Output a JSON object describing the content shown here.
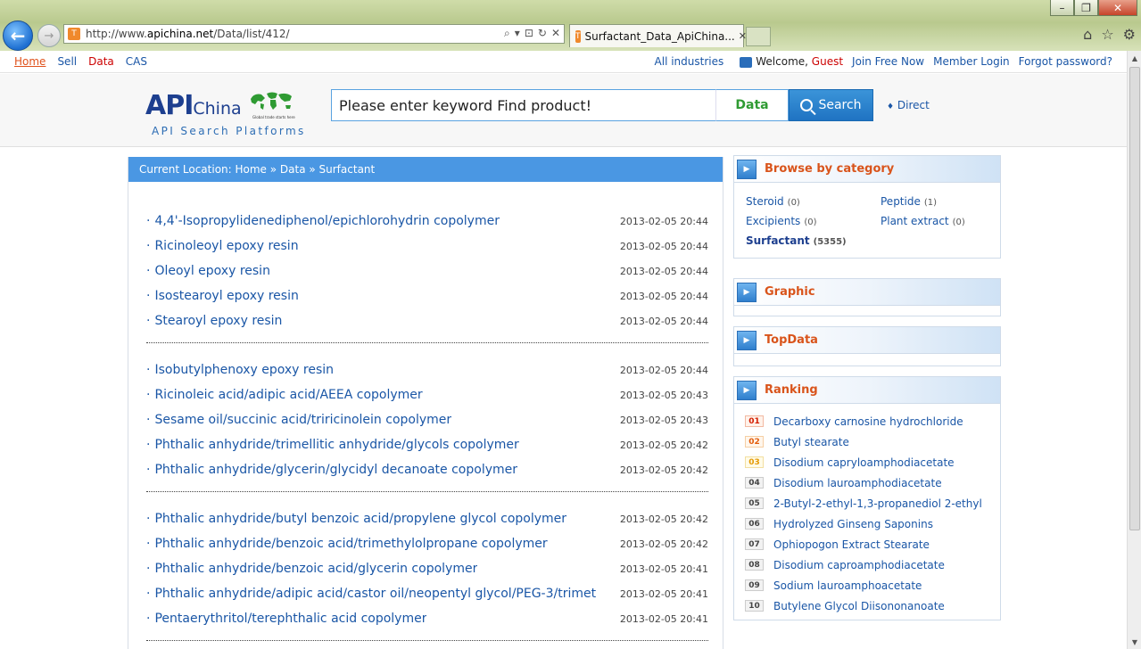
{
  "browser": {
    "url_prefix": "http://www.",
    "url_host": "apichina.net",
    "url_path": "/Data/list/412/",
    "tab_title": "Surfactant_Data_ApiChina...",
    "back_glyph": "←",
    "forward_glyph": "→",
    "minimize_glyph": "–",
    "maximize_glyph": "❐",
    "close_glyph": "✕",
    "addr_search_glyph": "⌕",
    "addr_dropdown_glyph": "▾",
    "addr_compat_glyph": "⊡",
    "addr_refresh_glyph": "↻",
    "addr_stop_glyph": "✕",
    "tab_close_glyph": "✕",
    "home_glyph": "⌂",
    "favorites_glyph": "☆",
    "tools_glyph": "⚙",
    "favicon_glyph": "T"
  },
  "topnav": {
    "home": "Home",
    "sell": "Sell",
    "data": "Data",
    "cas": "CAS",
    "all_industries": "All industries",
    "welcome": "Welcome,",
    "guest": "Guest",
    "join": "Join Free Now",
    "member_login": "Member Login",
    "forgot": "Forgot password?"
  },
  "header": {
    "logo_api": "API",
    "logo_china": "China",
    "logo_tagline": "Global trade starts here",
    "logo_sub": "API Search Platforms",
    "search_placeholder": "Please enter keyword Find product!",
    "search_type": "Data",
    "search_button": "Search",
    "direct": "Direct",
    "direct_glyph": "♦"
  },
  "breadcrumb": "Current Location: Home » Data » Surfactant",
  "list_groups": [
    [
      {
        "title": "4,4'-Isopropylidenediphenol/epichlorohydrin copolymer",
        "date": "2013-02-05 20:44"
      },
      {
        "title": "Ricinoleoyl epoxy resin",
        "date": "2013-02-05 20:44"
      },
      {
        "title": "Oleoyl epoxy resin",
        "date": "2013-02-05 20:44"
      },
      {
        "title": "Isostearoyl epoxy resin",
        "date": "2013-02-05 20:44"
      },
      {
        "title": "Stearoyl epoxy resin",
        "date": "2013-02-05 20:44"
      }
    ],
    [
      {
        "title": "Isobutylphenoxy epoxy resin",
        "date": "2013-02-05 20:44"
      },
      {
        "title": "Ricinoleic acid/adipic acid/AEEA copolymer",
        "date": "2013-02-05 20:43"
      },
      {
        "title": "Sesame oil/succinic acid/triricinolein copolymer",
        "date": "2013-02-05 20:43"
      },
      {
        "title": "Phthalic anhydride/trimellitic anhydride/glycols copolymer",
        "date": "2013-02-05 20:42"
      },
      {
        "title": "Phthalic anhydride/glycerin/glycidyl decanoate copolymer",
        "date": "2013-02-05 20:42"
      }
    ],
    [
      {
        "title": "Phthalic anhydride/butyl benzoic acid/propylene glycol copolymer",
        "date": "2013-02-05 20:42"
      },
      {
        "title": "Phthalic anhydride/benzoic acid/trimethylolpropane copolymer",
        "date": "2013-02-05 20:42"
      },
      {
        "title": "Phthalic anhydride/benzoic acid/glycerin copolymer",
        "date": "2013-02-05 20:41"
      },
      {
        "title": "Phthalic anhydride/adipic acid/castor oil/neopentyl glycol/PEG-3/trimet",
        "date": "2013-02-05 20:41"
      },
      {
        "title": "Pentaerythritol/terephthalic acid copolymer",
        "date": "2013-02-05 20:41"
      }
    ]
  ],
  "sidebar": {
    "box_icon_glyph": "▶",
    "categories_title": "Browse by category",
    "categories": [
      {
        "name": "Steroid",
        "count": "(0)",
        "active": false
      },
      {
        "name": "Peptide",
        "count": "(1)",
        "active": false
      },
      {
        "name": "Excipients",
        "count": "(0)",
        "active": false
      },
      {
        "name": "Plant extract",
        "count": "(0)",
        "active": false
      },
      {
        "name": "Surfactant",
        "count": "(5355)",
        "active": true
      }
    ],
    "graphic_title": "Graphic",
    "topdata_title": "TopData",
    "ranking_title": "Ranking",
    "ranking": [
      {
        "num": "01",
        "name": "Decarboxy carnosine hydrochloride"
      },
      {
        "num": "02",
        "name": "Butyl stearate"
      },
      {
        "num": "03",
        "name": "Disodium capryloamphodiacetate"
      },
      {
        "num": "04",
        "name": "Disodium lauroamphodiacetate"
      },
      {
        "num": "05",
        "name": "2-Butyl-2-ethyl-1,3-propanediol 2-ethyl"
      },
      {
        "num": "06",
        "name": "Hydrolyzed Ginseng Saponins"
      },
      {
        "num": "07",
        "name": "Ophiopogon Extract Stearate"
      },
      {
        "num": "08",
        "name": "Disodium caproamphodiacetate"
      },
      {
        "num": "09",
        "name": "Sodium lauroamphoacetate"
      },
      {
        "num": "10",
        "name": "Butylene Glycol Diisononanoate"
      }
    ]
  },
  "colors": {
    "link": "#1a56a6",
    "accent_orange": "#d9541b",
    "breadcrumb_bg": "#4a97e3",
    "data_green": "#2f9b33"
  }
}
